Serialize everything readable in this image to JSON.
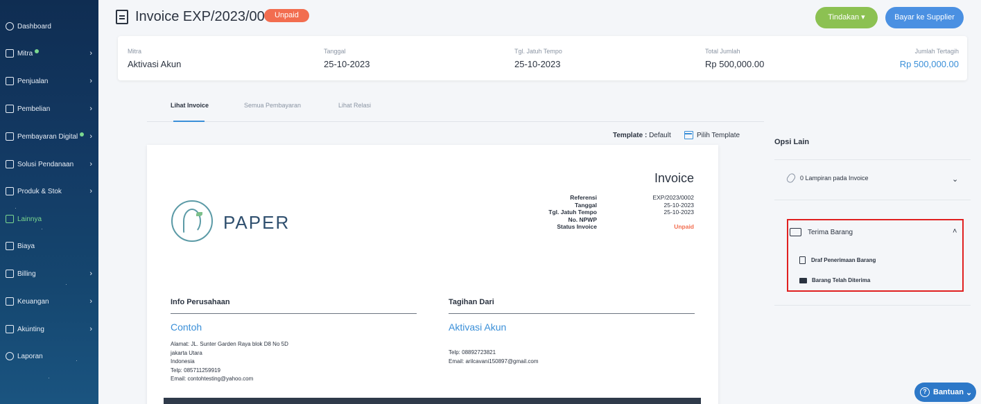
{
  "sidebar": {
    "items": [
      {
        "label": "Dashboard",
        "icon": "dashboard-icon"
      },
      {
        "label": "Mitra",
        "icon": "people-icon"
      },
      {
        "label": "Penjualan",
        "icon": "document-icon"
      },
      {
        "label": "Pembelian",
        "icon": "cart-icon"
      },
      {
        "label": "Pembayaran Digital",
        "icon": "card-icon"
      },
      {
        "label": "Solusi Pendanaan",
        "icon": "money-icon"
      },
      {
        "label": "Produk & Stok",
        "icon": "box-icon"
      },
      {
        "label": "Lainnya",
        "icon": "layers-icon"
      },
      {
        "label": "Biaya",
        "icon": "receipt-icon"
      },
      {
        "label": "Billing",
        "icon": "billing-icon"
      },
      {
        "label": "Keuangan",
        "icon": "bank-icon"
      },
      {
        "label": "Akunting",
        "icon": "scale-icon"
      },
      {
        "label": "Laporan",
        "icon": "chart-icon"
      }
    ]
  },
  "header": {
    "title": "Invoice EXP/2023/0002",
    "status_badge": "Unpaid",
    "tindakan_label": "Tindakan",
    "bayar_label": "Bayar ke Supplier"
  },
  "summary": {
    "mitra_label": "Mitra",
    "mitra_value": "Aktivasi Akun",
    "tanggal_label": "Tanggal",
    "tanggal_value": "25-10-2023",
    "jatuh_tempo_label": "Tgl. Jatuh Tempo",
    "jatuh_tempo_value": "25-10-2023",
    "total_label": "Total Jumlah",
    "total_value": "Rp 500,000.00",
    "tertagih_label": "Jumlah Tertagih",
    "tertagih_value": "Rp 500,000.00"
  },
  "tabs": [
    "Lihat Invoice",
    "Semua Pembayaran",
    "Lihat Relasi"
  ],
  "template": {
    "label": "Template :",
    "value": "Default",
    "pilih_label": "Pilih Template"
  },
  "invoice": {
    "logo_text": "PAPER",
    "title": "Invoice",
    "meta_labels": [
      "Referensi",
      "Tanggal",
      "Tgl. Jatuh Tempo",
      "No. NPWP",
      "Status Invoice"
    ],
    "meta_values": [
      "EXP/2023/0002",
      "25-10-2023",
      "25-10-2023",
      "",
      "Unpaid"
    ],
    "info_perusahaan": {
      "heading": "Info Perusahaan",
      "name": "Contoh",
      "lines": [
        "Alamat: JL. Sunter Garden Raya blok D8 No 5D",
        "jakarta Utara",
        "Indonesia",
        "Telp: 085711259919",
        "Email: contohtesting@yahoo.com"
      ]
    },
    "tagihan_dari": {
      "heading": "Tagihan Dari",
      "name": "Aktivasi Akun",
      "lines": [
        "Telp: 08892723821",
        "Email: arilcavani150897@gmail.com"
      ]
    }
  },
  "opsi": {
    "title": "Opsi Lain",
    "lampiran_label": "0 Lampiran pada Invoice",
    "terima_label": "Terima Barang",
    "draf_label": "Draf Penerimaan Barang",
    "diterima_label": "Barang Telah Diterima"
  },
  "bantuan_label": "Bantuan",
  "colors": {
    "accent": "#3a8fd8",
    "unpaid": "#f26d4f",
    "tindakan": "#8cc152",
    "bayar": "#4a90e2",
    "highlight": "#e02020"
  }
}
